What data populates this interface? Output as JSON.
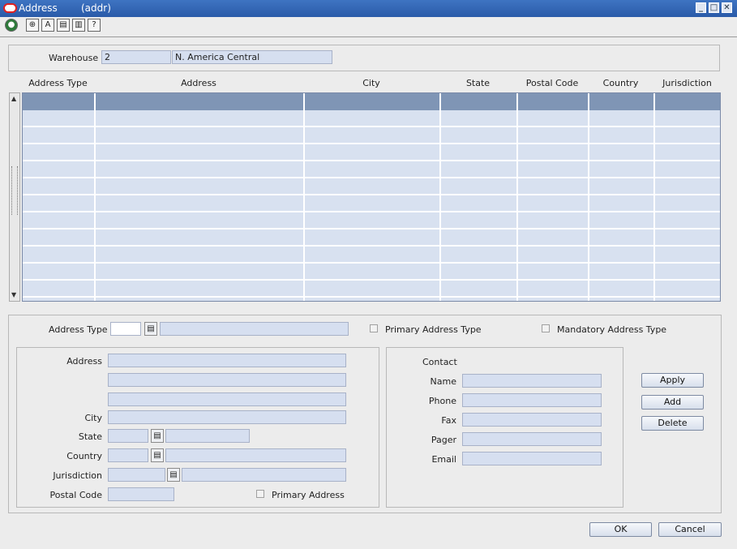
{
  "window": {
    "title": "Address",
    "subtitle": "(addr)",
    "minimize": "_",
    "maximize": "□",
    "close": "✕"
  },
  "toolbar": {
    "icons": [
      "globe-icon",
      "help-web-icon",
      "spellcheck-icon",
      "copy-icon",
      "print-icon",
      "help-icon"
    ]
  },
  "warehouse": {
    "label": "Warehouse",
    "id": "2",
    "name": "N. America Central"
  },
  "table": {
    "columns": [
      "Address Type",
      "Address",
      "City",
      "State",
      "Postal Code",
      "Country",
      "Jurisdiction"
    ],
    "rows": []
  },
  "form": {
    "address_type_label": "Address Type",
    "address_type_value": "",
    "address_type_desc": "",
    "primary_address_type_label": "Primary Address Type",
    "mandatory_address_type_label": "Mandatory Address Type",
    "address_label": "Address",
    "city_label": "City",
    "state_label": "State",
    "country_label": "Country",
    "jurisdiction_label": "Jurisdiction",
    "postal_code_label": "Postal Code",
    "primary_address_label": "Primary Address",
    "contact_label": "Contact",
    "name_label": "Name",
    "phone_label": "Phone",
    "fax_label": "Fax",
    "pager_label": "Pager",
    "email_label": "Email"
  },
  "buttons": {
    "apply": "Apply",
    "add": "Add",
    "delete": "Delete",
    "ok": "OK",
    "cancel": "Cancel"
  },
  "colors": {
    "titlebar": "#2a5aa8",
    "field": "#d6dff0",
    "grid_header": "#7f95b5"
  }
}
